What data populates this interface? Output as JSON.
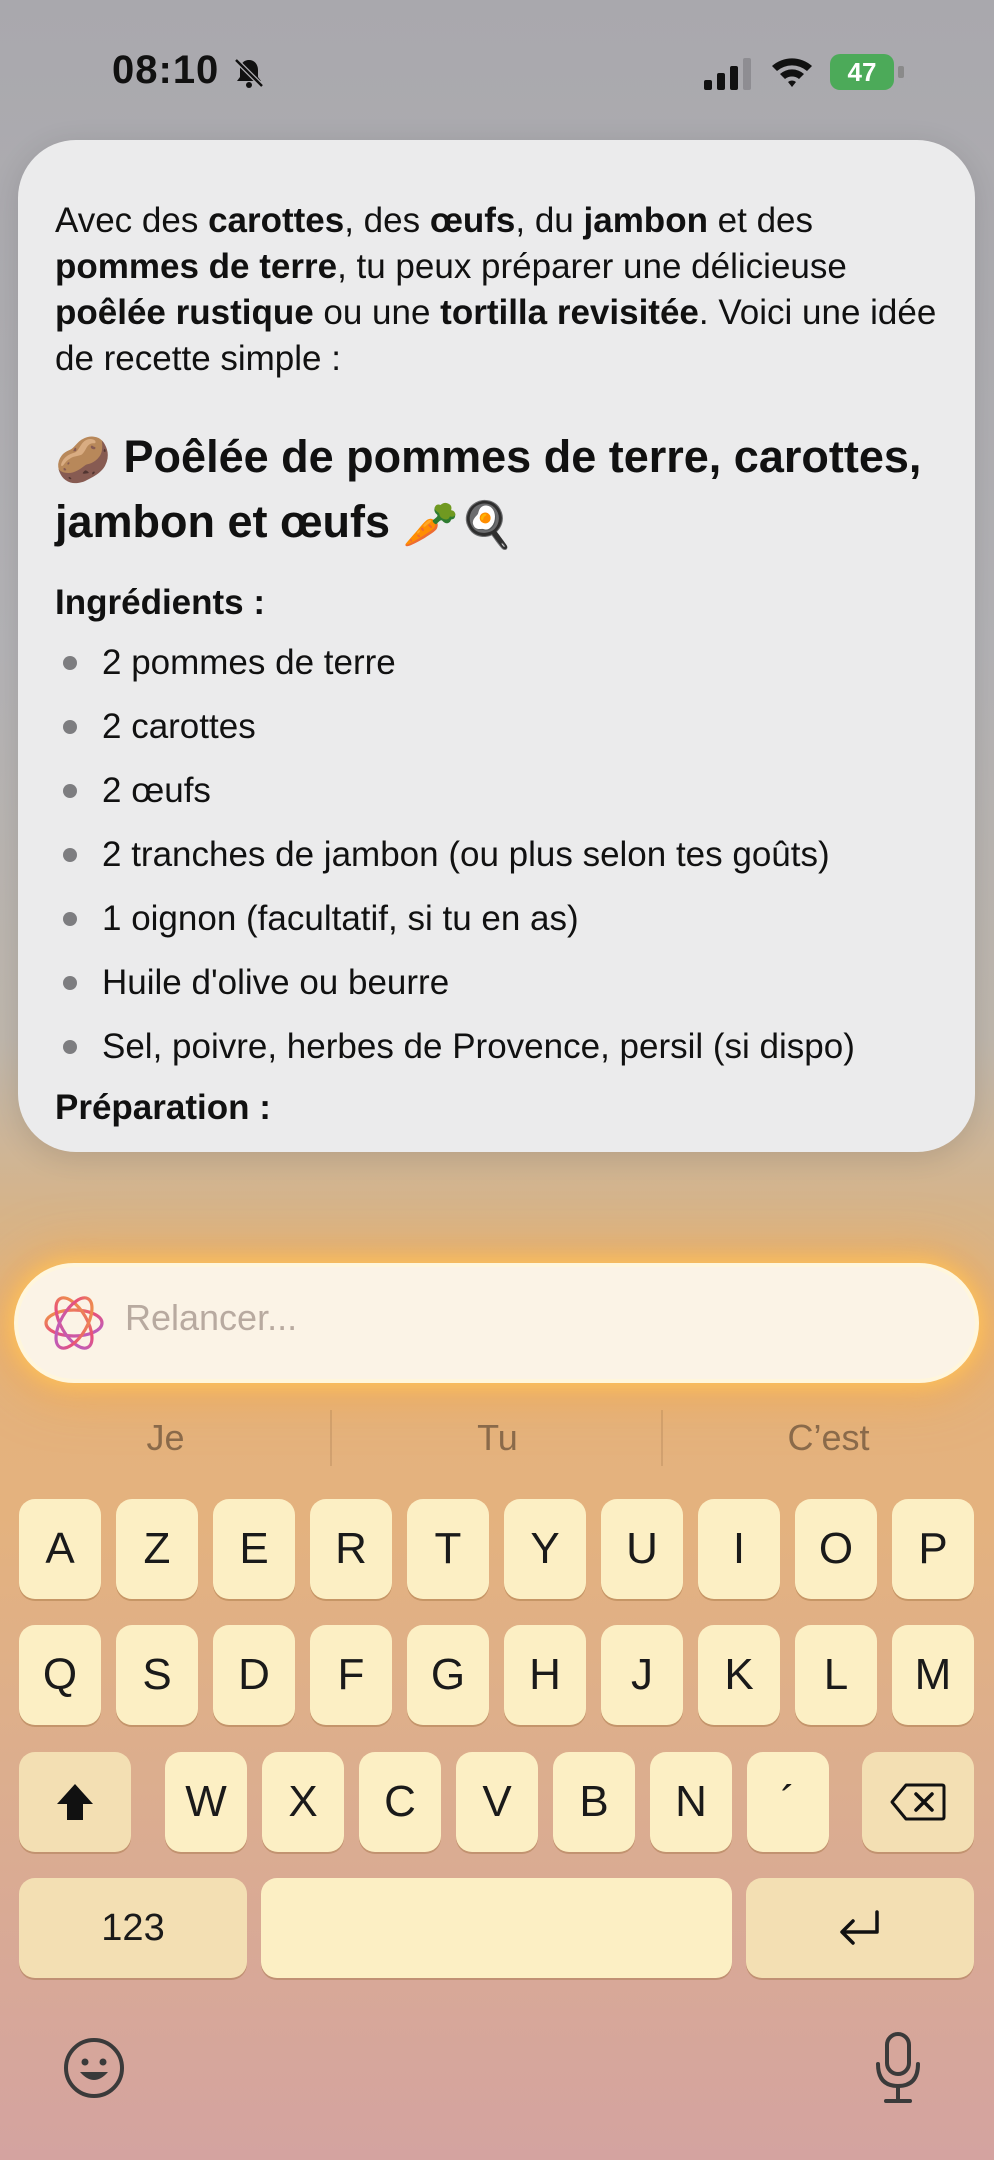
{
  "status": {
    "time": "08:10",
    "battery": "47"
  },
  "response": {
    "intro": [
      {
        "t": "Avec des ",
        "b": false
      },
      {
        "t": "carottes",
        "b": true
      },
      {
        "t": ", des ",
        "b": false
      },
      {
        "t": "œufs",
        "b": true
      },
      {
        "t": ", du ",
        "b": false
      },
      {
        "t": "jambon",
        "b": true
      },
      {
        "t": " et des ",
        "b": false
      },
      {
        "t": "pommes de terre",
        "b": true
      },
      {
        "t": ", tu peux préparer une délicieuse ",
        "b": false
      },
      {
        "t": "poêlée rustique",
        "b": true
      },
      {
        "t": " ou une ",
        "b": false
      },
      {
        "t": "tortilla revisitée",
        "b": true
      },
      {
        "t": ". Voici une idée de recette simple :",
        "b": false
      }
    ],
    "title_emoji_left": "🥔",
    "title": "Poêlée de pommes de terre, carottes, jambon et œufs",
    "title_emoji_right": "🥕🍳",
    "ingredients_label": "Ingrédients :",
    "ingredients": [
      "2 pommes de terre",
      "2 carottes",
      "2 œufs",
      "2 tranches de jambon (ou plus selon tes goûts)",
      "1 oignon (facultatif, si tu en as)",
      "Huile d'olive ou beurre",
      "Sel, poivre, herbes de Provence, persil (si dispo)"
    ],
    "preparation_label": "Préparation :"
  },
  "input": {
    "placeholder": "Relancer..."
  },
  "predictions": [
    "Je",
    "Tu",
    "C’est"
  ],
  "keyboard": {
    "row1": [
      "A",
      "Z",
      "E",
      "R",
      "T",
      "Y",
      "U",
      "I",
      "O",
      "P"
    ],
    "row2": [
      "Q",
      "S",
      "D",
      "F",
      "G",
      "H",
      "J",
      "K",
      "L",
      "M"
    ],
    "row3": [
      "W",
      "X",
      "C",
      "V",
      "B",
      "N",
      "´"
    ],
    "numbers_label": "123"
  },
  "icons": {
    "bell": "bell-slash-icon",
    "signal": "cellular-signal-icon",
    "wifi": "wifi-icon",
    "battery": "battery-charging-icon",
    "ai": "apple-intelligence-icon",
    "shift": "shift-icon",
    "delete": "delete-icon",
    "return": "return-icon",
    "emoji": "emoji-icon",
    "mic": "microphone-icon"
  }
}
